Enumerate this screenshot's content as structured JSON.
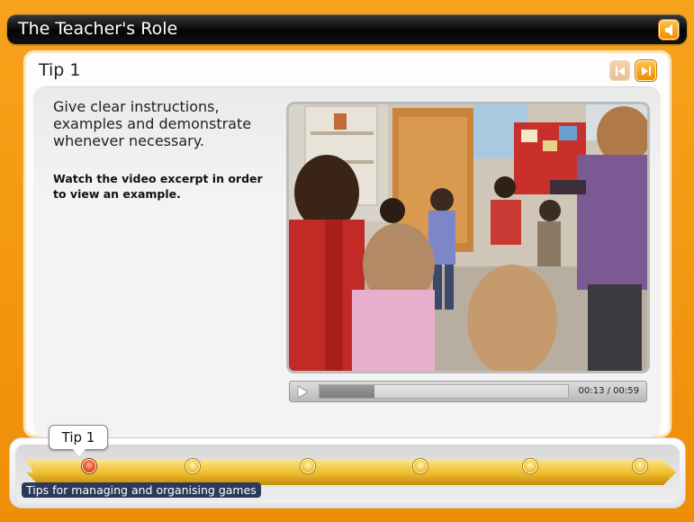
{
  "app": {
    "title": "The Teacher's Role"
  },
  "tip": {
    "heading": "Tip 1",
    "instruction": "Give clear instructions, examples and demonstrate whenever necessary.",
    "sub_instruction": "Watch the video excerpt in order to view an example."
  },
  "video": {
    "time": "00:13 / 00:59",
    "progress": 0.22
  },
  "timeline": {
    "current_label": "Tip 1",
    "section_label": "Tips for managing and organising games",
    "dots": 6,
    "active_index": 0
  },
  "icons": {
    "sound": "speaker-icon",
    "prev": "previous-icon",
    "next": "next-icon",
    "play": "play-icon"
  },
  "colors": {
    "frame": "#f39c0f",
    "accent": "#f08d07",
    "active_dot": "#e24a18",
    "label_bg": "#2c3a5a"
  }
}
